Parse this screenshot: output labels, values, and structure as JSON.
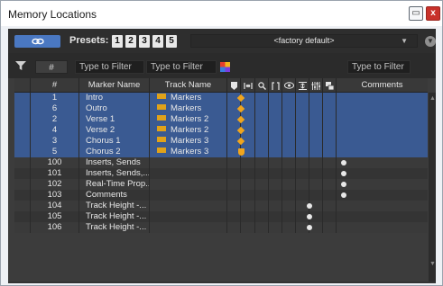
{
  "window": {
    "title": "Memory Locations",
    "restore": "▭",
    "close": "x"
  },
  "toolbar": {
    "presets_label": "Presets:",
    "presets": [
      "1",
      "2",
      "3",
      "4",
      "5"
    ],
    "factory_default": "<factory default>"
  },
  "filters": {
    "hash": "#",
    "filter1": "Type to Filter",
    "filter2": "Type to Filter",
    "filter3": "Type to Filter"
  },
  "table": {
    "headers": {
      "num": "#",
      "marker_name": "Marker Name",
      "track_name": "Track Name",
      "comments": "Comments"
    },
    "rows": [
      {
        "num": "1",
        "name": "Intro",
        "track": "Markers",
        "marker": "diamond",
        "dot": null
      },
      {
        "num": "6",
        "name": "Outro",
        "track": "Markers",
        "marker": "diamond",
        "dot": null
      },
      {
        "num": "2",
        "name": "Verse 1",
        "track": "Markers 2",
        "marker": "diamond",
        "dot": null
      },
      {
        "num": "4",
        "name": "Verse 2",
        "track": "Markers 2",
        "marker": "diamond",
        "dot": null
      },
      {
        "num": "3",
        "name": "Chorus 1",
        "track": "Markers 3",
        "marker": "diamond",
        "dot": null
      },
      {
        "num": "5",
        "name": "Chorus 2",
        "track": "Markers 3",
        "marker": "shield",
        "dot": null
      },
      {
        "num": "100",
        "name": "Inserts, Sends",
        "track": "",
        "marker": null,
        "dot": "comments-col"
      },
      {
        "num": "101",
        "name": "Inserts, Sends,...",
        "track": "",
        "marker": null,
        "dot": "comments-col"
      },
      {
        "num": "102",
        "name": "Real-Time Prop...",
        "track": "",
        "marker": null,
        "dot": "comments-col"
      },
      {
        "num": "103",
        "name": "Comments",
        "track": "",
        "marker": null,
        "dot": "comments-col"
      },
      {
        "num": "104",
        "name": "Track Height -...",
        "track": "",
        "marker": null,
        "dot": "eye-col"
      },
      {
        "num": "105",
        "name": "Track Height -...",
        "track": "",
        "marker": null,
        "dot": "eye-col"
      },
      {
        "num": "106",
        "name": "Track Height -...",
        "track": "",
        "marker": null,
        "dot": "eye-col"
      }
    ]
  },
  "colors": {
    "accent_blue": "#4a78c2",
    "marker_orange": "#f0a51d",
    "selected_row": "#3a5a92",
    "close_red": "#c8312a"
  }
}
